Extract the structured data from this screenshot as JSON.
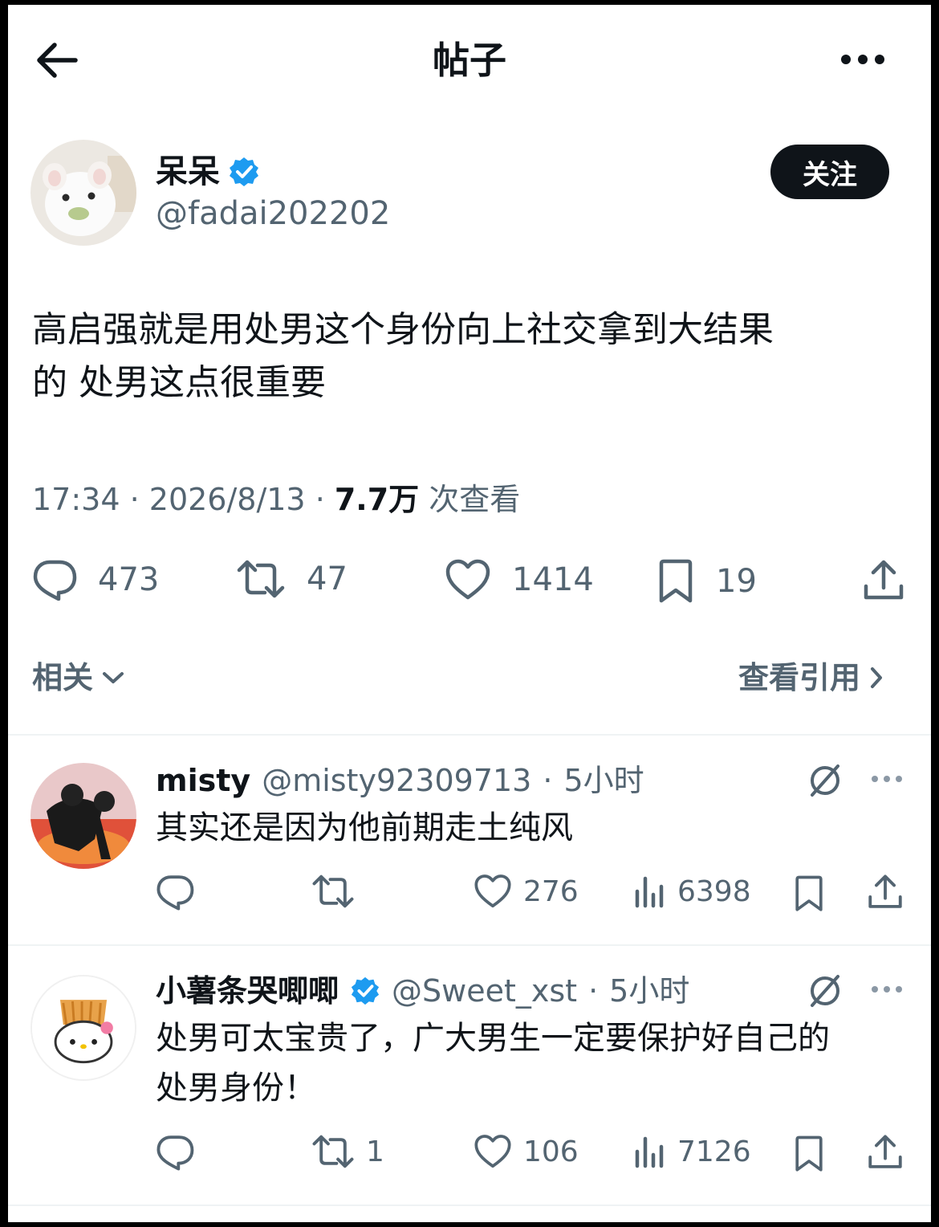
{
  "header": {
    "title": "帖子"
  },
  "post": {
    "author_name": "呆呆",
    "author_handle": "@fadai202202",
    "follow_label": "关注",
    "text_line1": "高启强就是用处男这个身份向上社交拿到大结果",
    "text_line2": "的 处男这点很重要",
    "time": "17:34",
    "date": "2026/8/13",
    "views_count": "7.7万",
    "views_label": "次查看",
    "replies": "473",
    "reposts": "47",
    "likes": "1414",
    "bookmarks": "19"
  },
  "related": {
    "label": "相关",
    "quotes_label": "查看引用"
  },
  "comments": [
    {
      "name": "misty",
      "handle": "@misty92309713",
      "time": "5小时",
      "text": "其实还是因为他前期走土纯风",
      "replies": "",
      "reposts": "",
      "likes": "276",
      "views": "6398"
    },
    {
      "name": "小薯条哭唧唧",
      "handle": "@Sweet_xst",
      "time": "5小时",
      "text_line1": "处男可太宝贵了，广大男生一定要保护好自己的",
      "text_line2": "处男身份！",
      "replies": "",
      "reposts": "1",
      "likes": "106",
      "views": "7126"
    }
  ],
  "colors": {
    "verified": "#1d9bf0",
    "text": "#0f1419",
    "secondary": "#536471"
  }
}
